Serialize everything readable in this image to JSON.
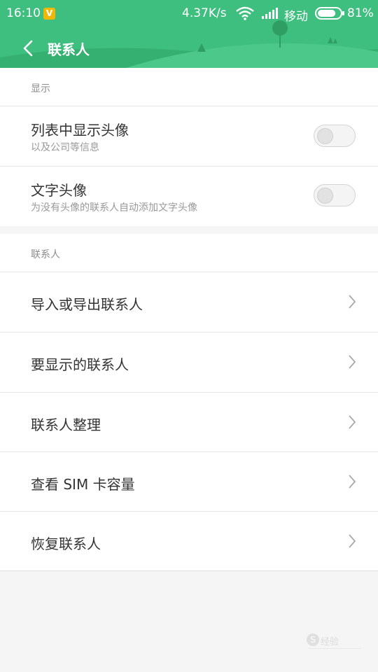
{
  "status_bar": {
    "time": "16:10",
    "badge": "V",
    "net_speed": "4.37K/s",
    "carrier": "移动",
    "battery_percent": "81%",
    "battery_level": 0.81
  },
  "nav": {
    "title": "联系人"
  },
  "display_section": {
    "header": "显示",
    "rows": [
      {
        "title": "列表中显示头像",
        "subtitle": "以及公司等信息",
        "enabled": false
      },
      {
        "title": "文字头像",
        "subtitle": "为没有头像的联系人自动添加文字头像",
        "enabled": false
      }
    ]
  },
  "contacts_section": {
    "header": "联系人",
    "rows": [
      {
        "title": "导入或导出联系人"
      },
      {
        "title": "要显示的联系人"
      },
      {
        "title": "联系人整理"
      },
      {
        "title": "查看 SIM 卡容量"
      },
      {
        "title": "恢复联系人"
      }
    ]
  },
  "watermark": {
    "text": "经验"
  },
  "colors": {
    "header_green": "#3fbf7f",
    "text_primary": "#333333",
    "text_secondary": "#999999"
  }
}
